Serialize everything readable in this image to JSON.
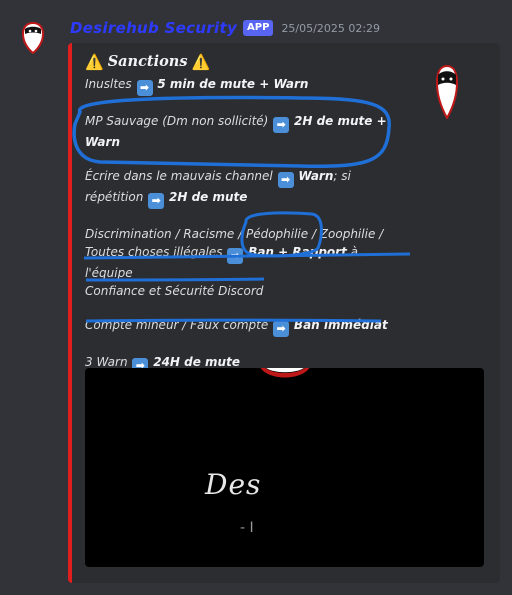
{
  "message": {
    "author": "Desirehub Security",
    "badge": "APP",
    "timestamp": "25/05/2025 02:29"
  },
  "embed": {
    "title_icon": "⚠️",
    "title": "Sanctions",
    "arrow_icon": "➡",
    "lines": {
      "insults_prefix": "Inusltes",
      "insults_penalty": "5 min de mute + Warn",
      "mp_prefix": "MP Sauvage (Dm non sollicité)",
      "mp_penalty_a": "2H de mute +",
      "mp_penalty_b": "Warn",
      "channel_prefix_a": "Écrire dans le mauvais channel",
      "channel_penalty_a": "Warn",
      "channel_prefix_b": "; si",
      "channel_prefix_c": "répétition",
      "channel_penalty_b": "2H de mute",
      "discrim_a": "Discrimination / Racisme / Pédophilie / Zoophilie /",
      "discrim_b": "Toutes choses illégales",
      "discrim_penalty": "Ban + Rapport",
      "discrim_tail": "à l'équipe",
      "discrim_c": "Confiance et Sécurité Discord",
      "minor_prefix": "Compte mineur / Faux compte",
      "minor_penalty": "Ban immédiat",
      "warn_prefix": "3 Warn",
      "warn_penalty": "24H de mute"
    },
    "image": {
      "logo_text": "Des",
      "sub_text": "- I"
    },
    "colors": {
      "bar": "#e01e1e",
      "author": "#2e3bff",
      "annotation": "#1f6fd6"
    }
  }
}
